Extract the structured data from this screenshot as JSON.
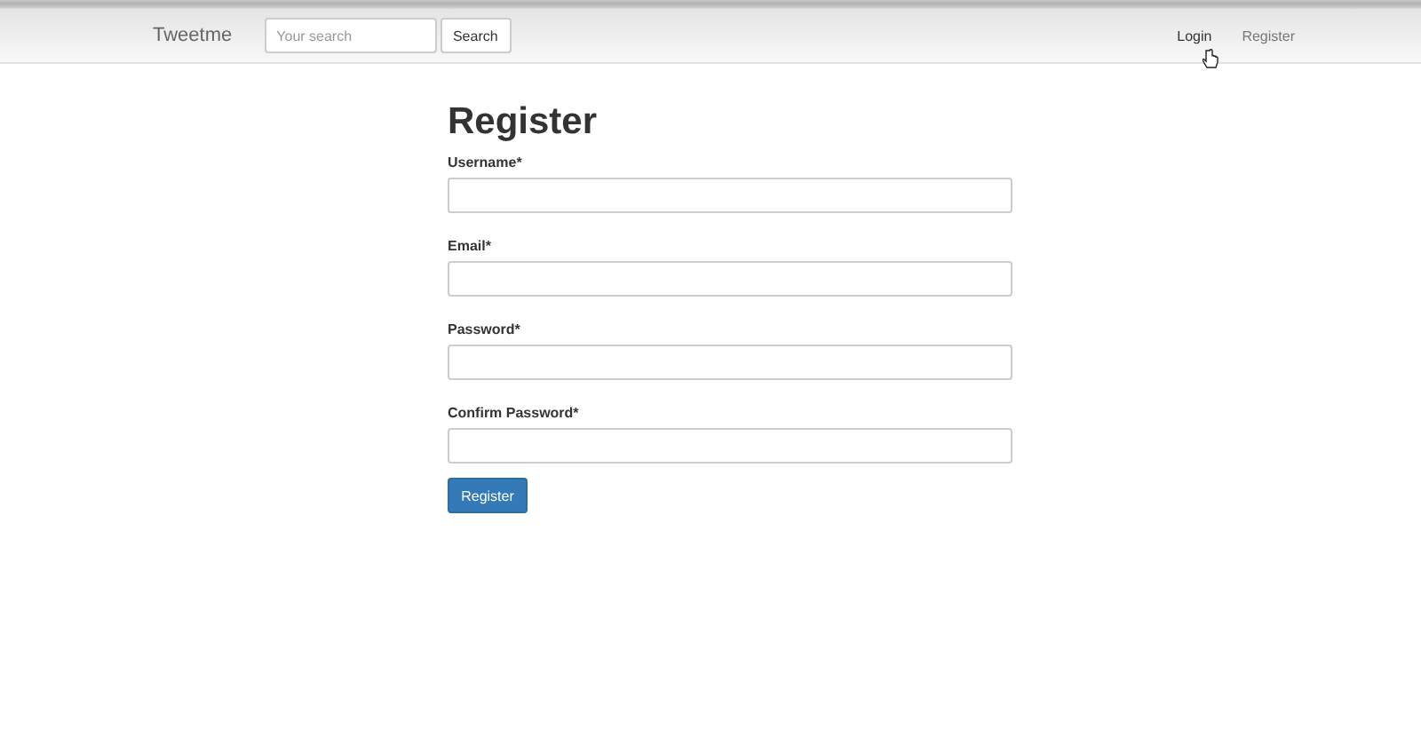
{
  "navbar": {
    "brand": "Tweetme",
    "search": {
      "placeholder": "Your search"
    },
    "search_button": "Search",
    "links": [
      {
        "label": "Login"
      },
      {
        "label": "Register"
      }
    ]
  },
  "form": {
    "title": "Register",
    "fields": [
      {
        "label": "Username*"
      },
      {
        "label": "Email*"
      },
      {
        "label": "Password*"
      },
      {
        "label": "Confirm Password*"
      }
    ],
    "submit": "Register"
  }
}
